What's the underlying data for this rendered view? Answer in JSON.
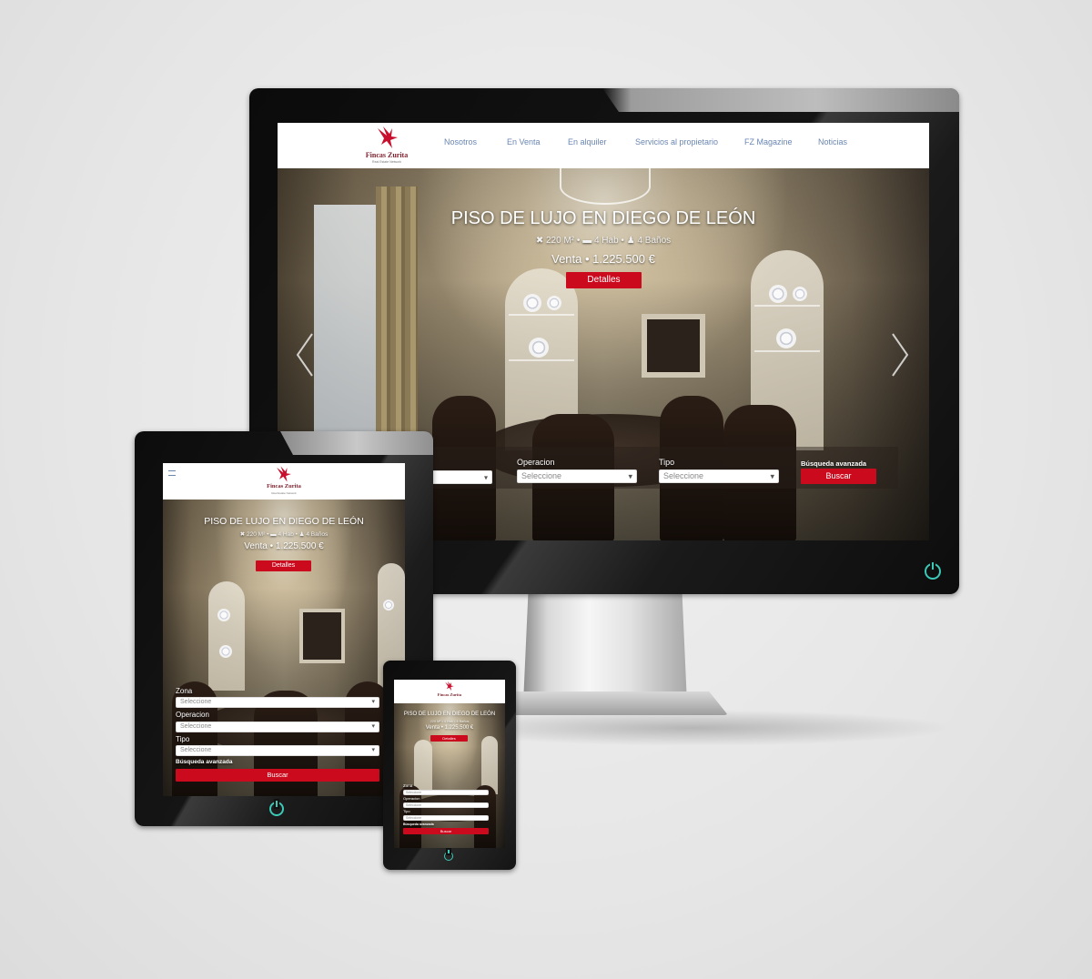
{
  "brand": {
    "name": "Fincas Zurita",
    "tagline": "Real Estate Network",
    "color": "#cc0a1e"
  },
  "nav": {
    "items": [
      {
        "label": "Nosotros"
      },
      {
        "label": "En Venta"
      },
      {
        "label": "En alquiler"
      },
      {
        "label": "Servicios al propietario"
      },
      {
        "label": "FZ Magazine"
      },
      {
        "label": "Noticias"
      }
    ]
  },
  "hero": {
    "title": "PISO DE LUJO EN DIEGO DE LEÓN",
    "area": "220 M²",
    "rooms": "4 Hab",
    "baths": "4 Baños",
    "operation": "Venta",
    "price": "1.225.500 €",
    "details_button": "Detalles"
  },
  "search": {
    "zona_label": "Zona",
    "operacion_label": "Operacion",
    "tipo_label": "Tipo",
    "placeholder": "Seleccione",
    "advanced_label": "Búsqueda avanzada",
    "search_button": "Buscar"
  },
  "icons": {
    "prev": "chevron-left-icon",
    "next": "chevron-right-icon",
    "menu": "hamburger-icon",
    "power": "power-icon"
  },
  "colors": {
    "accent": "#cc0a1e",
    "nav_link": "#6a86b3",
    "power_led": "#3cc9b8"
  }
}
